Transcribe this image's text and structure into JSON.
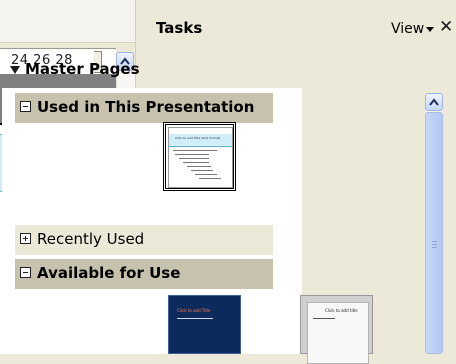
{
  "document": {
    "ruler_numbers": "24  26  28",
    "slide_title_fragment": "d"
  },
  "tasks_pane": {
    "title": "Tasks",
    "view_label": "View",
    "close_glyph": "✕",
    "master_pages_label": "Master Pages",
    "sections": {
      "used": "Used in This Presentation",
      "recent": "Recently Used",
      "available": "Available for Use"
    },
    "thumbnails": {
      "used_title": "Click to add Title (text format)",
      "avail1_title": "Click to add Title",
      "avail2_title": "Click to add title"
    }
  },
  "colors": {
    "window_bg": "#ece9d8",
    "section_header": "#c7c2ae",
    "scrollbar_blue": "#b3c8f3",
    "slide_title_fill": "#cfeef8"
  },
  "icons": [
    "chevron-up-icon",
    "close-icon",
    "dropdown-arrow-icon",
    "collapse-triangle-icon",
    "minus-box-icon",
    "plus-box-icon"
  ]
}
